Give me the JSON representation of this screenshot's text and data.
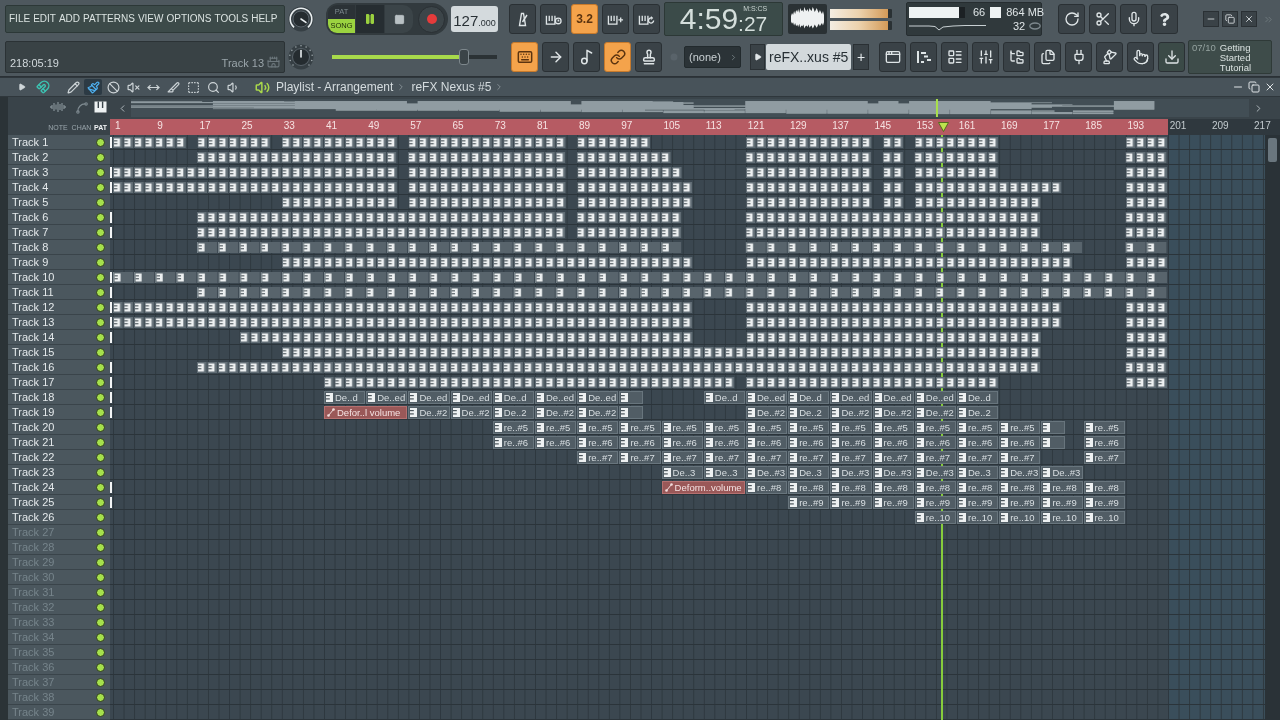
{
  "menu": [
    "FILE",
    "EDIT",
    "ADD",
    "PATTERNS",
    "VIEW",
    "OPTIONS",
    "TOOLS",
    "HELP"
  ],
  "modes": [
    {
      "label": "PAT",
      "selected": false
    },
    {
      "label": "SONG",
      "selected": true
    }
  ],
  "playing": true,
  "tempo": {
    "whole": "127",
    "fraction": ".000"
  },
  "record_tools": [
    {
      "active": false
    },
    {
      "active": false
    },
    {
      "label": "3.2",
      "active": true
    },
    {
      "active": false
    },
    {
      "active": false
    }
  ],
  "time": {
    "main": "4:59",
    "fraction": ":27",
    "format": "M:S:CS"
  },
  "peak_meters": [
    {
      "level": 0.93
    },
    {
      "level": 0.94
    }
  ],
  "cpu": {
    "level": 0.9,
    "reading": "66",
    "memory": "864 MB",
    "polyphony": "32"
  },
  "hint_bar": {
    "position": "218:05:19",
    "hint": "Track 13"
  },
  "main_slider": {
    "level": 0.8
  },
  "edit_tools": [
    {
      "active": true
    },
    {
      "active": false
    },
    {
      "active": false
    },
    {
      "active": true
    },
    {
      "active": false
    }
  ],
  "channel_selector": "(none)",
  "pattern_selector": {
    "value": "reFX..xus #5",
    "add": "+"
  },
  "tutorial": {
    "counter": "07/10",
    "title": "Getting Started Tutorial"
  },
  "playlist": {
    "title": "Playlist - Arrangement",
    "pattern": "reFX Nexus #5",
    "snap_on": true,
    "tools": [
      {
        "selected": false
      },
      {
        "selected": true
      },
      {
        "selected": false
      },
      {
        "selected": false
      },
      {
        "selected": false
      },
      {
        "selected": false
      },
      {
        "selected": false
      },
      {
        "selected": false
      },
      {
        "selected": false
      }
    ]
  },
  "filters": [
    {
      "label": "NOTE",
      "selected": false
    },
    {
      "label": "CHAN",
      "selected": false
    },
    {
      "label": "PAT",
      "selected": true
    }
  ],
  "ruler": [
    {
      "label": "1",
      "in_song": true
    },
    {
      "label": "9",
      "in_song": true
    },
    {
      "label": "17",
      "in_song": true
    },
    {
      "label": "25",
      "in_song": true
    },
    {
      "label": "33",
      "in_song": true
    },
    {
      "label": "41",
      "in_song": true
    },
    {
      "label": "49",
      "in_song": true
    },
    {
      "label": "57",
      "in_song": true
    },
    {
      "label": "65",
      "in_song": true
    },
    {
      "label": "73",
      "in_song": true
    },
    {
      "label": "81",
      "in_song": true
    },
    {
      "label": "89",
      "in_song": true
    },
    {
      "label": "97",
      "in_song": true
    },
    {
      "label": "105",
      "in_song": true
    },
    {
      "label": "113",
      "in_song": true
    },
    {
      "label": "121",
      "in_song": true
    },
    {
      "label": "129",
      "in_song": true
    },
    {
      "label": "137",
      "in_song": true
    },
    {
      "label": "145",
      "in_song": true
    },
    {
      "label": "153",
      "in_song": true
    },
    {
      "label": "161",
      "in_song": true
    },
    {
      "label": "169",
      "in_song": true
    },
    {
      "label": "177",
      "in_song": true
    },
    {
      "label": "185",
      "in_song": true
    },
    {
      "label": "193",
      "in_song": true
    },
    {
      "label": "201",
      "in_song": false
    },
    {
      "label": "209",
      "in_song": false
    },
    {
      "label": "217",
      "in_song": false
    }
  ],
  "playhead": {
    "level": 0.72
  },
  "tracks": [
    {
      "name": "Track 1",
      "dimmed": false,
      "on": true,
      "marker": true
    },
    {
      "name": "Track 2",
      "dimmed": false,
      "on": true,
      "marker": false
    },
    {
      "name": "Track 3",
      "dimmed": false,
      "on": true,
      "marker": true
    },
    {
      "name": "Track 4",
      "dimmed": false,
      "on": true,
      "marker": true
    },
    {
      "name": "Track 5",
      "dimmed": false,
      "on": true,
      "marker": false
    },
    {
      "name": "Track 6",
      "dimmed": false,
      "on": true,
      "marker": true
    },
    {
      "name": "Track 7",
      "dimmed": false,
      "on": true,
      "marker": true
    },
    {
      "name": "Track 8",
      "dimmed": false,
      "on": true,
      "marker": false
    },
    {
      "name": "Track 9",
      "dimmed": false,
      "on": true,
      "marker": false
    },
    {
      "name": "Track 10",
      "dimmed": false,
      "on": true,
      "marker": true
    },
    {
      "name": "Track 11",
      "dimmed": false,
      "on": true,
      "marker": true
    },
    {
      "name": "Track 12",
      "dimmed": false,
      "on": true,
      "marker": true
    },
    {
      "name": "Track 13",
      "dimmed": false,
      "on": true,
      "marker": true
    },
    {
      "name": "Track 14",
      "dimmed": false,
      "on": true,
      "marker": true
    },
    {
      "name": "Track 15",
      "dimmed": false,
      "on": true,
      "marker": false
    },
    {
      "name": "Track 16",
      "dimmed": false,
      "on": true,
      "marker": true
    },
    {
      "name": "Track 17",
      "dimmed": false,
      "on": true,
      "marker": true
    },
    {
      "name": "Track 18",
      "dimmed": false,
      "on": true,
      "marker": true,
      "lane": [
        {
          "kind": "empty"
        },
        {
          "kind": "empty"
        },
        {
          "kind": "empty"
        },
        {
          "kind": "empty"
        },
        {
          "kind": "empty"
        },
        {
          "kind": "pattern",
          "label": "De..d"
        },
        {
          "kind": "pattern",
          "label": "De..ed"
        },
        {
          "kind": "pattern",
          "label": "De..ed"
        },
        {
          "kind": "pattern",
          "label": "De..ed"
        },
        {
          "kind": "pattern",
          "label": "De..d"
        },
        {
          "kind": "pattern",
          "label": "De..ed"
        },
        {
          "kind": "pattern",
          "label": "De..ed"
        },
        {
          "kind": "stub"
        },
        {
          "kind": "empty"
        },
        {
          "kind": "pattern",
          "label": "De..d"
        },
        {
          "kind": "pattern",
          "label": "De..ed"
        },
        {
          "kind": "pattern",
          "label": "De..d"
        },
        {
          "kind": "pattern",
          "label": "De..ed"
        },
        {
          "kind": "pattern",
          "label": "De..ed"
        },
        {
          "kind": "pattern",
          "label": "De..ed"
        },
        {
          "kind": "pattern",
          "label": "De..d"
        }
      ]
    },
    {
      "name": "Track 19",
      "dimmed": false,
      "on": true,
      "marker": true,
      "lane": [
        {
          "kind": "empty"
        },
        {
          "kind": "empty"
        },
        {
          "kind": "empty"
        },
        {
          "kind": "empty"
        },
        {
          "kind": "empty"
        },
        {
          "kind": "automation",
          "label": "Defor..l volume"
        },
        {
          "kind": "pattern",
          "label": "De..#2"
        },
        {
          "kind": "pattern",
          "label": "De..#2"
        },
        {
          "kind": "pattern",
          "label": "De..2"
        },
        {
          "kind": "pattern",
          "label": "De..#2"
        },
        {
          "kind": "pattern",
          "label": "De..#2"
        },
        {
          "kind": "stub"
        },
        {
          "kind": "empty"
        },
        {
          "kind": "empty"
        },
        {
          "kind": "pattern",
          "label": "De..#2"
        },
        {
          "kind": "pattern",
          "label": "De..2"
        },
        {
          "kind": "pattern",
          "label": "De..#2"
        },
        {
          "kind": "pattern",
          "label": "De..#2"
        },
        {
          "kind": "pattern",
          "label": "De..#2"
        },
        {
          "kind": "pattern",
          "label": "De..2"
        }
      ]
    },
    {
      "name": "Track 20",
      "dimmed": false,
      "on": true,
      "marker": false,
      "lane": [
        {
          "kind": "empty"
        },
        {
          "kind": "empty"
        },
        {
          "kind": "empty"
        },
        {
          "kind": "empty"
        },
        {
          "kind": "empty"
        },
        {
          "kind": "empty"
        },
        {
          "kind": "empty"
        },
        {
          "kind": "empty"
        },
        {
          "kind": "empty"
        },
        {
          "kind": "pattern",
          "label": "re..#5"
        },
        {
          "kind": "pattern",
          "label": "re..#5"
        },
        {
          "kind": "pattern",
          "label": "re..#5"
        },
        {
          "kind": "pattern",
          "label": "re..#5"
        },
        {
          "kind": "pattern",
          "label": "re..#5"
        },
        {
          "kind": "pattern",
          "label": "re..#5"
        },
        {
          "kind": "pattern",
          "label": "re..#5"
        },
        {
          "kind": "pattern",
          "label": "re..#5"
        },
        {
          "kind": "pattern",
          "label": "re..#5"
        },
        {
          "kind": "pattern",
          "label": "re..#5"
        },
        {
          "kind": "pattern",
          "label": "re..#5"
        },
        {
          "kind": "pattern",
          "label": "re..#5"
        },
        {
          "kind": "pattern",
          "label": "re..#5"
        },
        {
          "kind": "stub"
        },
        {
          "kind": "pattern",
          "label": "re..#5"
        }
      ]
    },
    {
      "name": "Track 21",
      "dimmed": false,
      "on": true,
      "marker": false,
      "lane": [
        {
          "kind": "empty"
        },
        {
          "kind": "empty"
        },
        {
          "kind": "empty"
        },
        {
          "kind": "empty"
        },
        {
          "kind": "empty"
        },
        {
          "kind": "empty"
        },
        {
          "kind": "empty"
        },
        {
          "kind": "empty"
        },
        {
          "kind": "empty"
        },
        {
          "kind": "pattern",
          "label": "re..#6"
        },
        {
          "kind": "pattern",
          "label": "re..#6"
        },
        {
          "kind": "pattern",
          "label": "re..#6"
        },
        {
          "kind": "pattern",
          "label": "re..#6"
        },
        {
          "kind": "pattern",
          "label": "re..#6"
        },
        {
          "kind": "pattern",
          "label": "re..#6"
        },
        {
          "kind": "pattern",
          "label": "re..#6"
        },
        {
          "kind": "pattern",
          "label": "re..#6"
        },
        {
          "kind": "pattern",
          "label": "re..#6"
        },
        {
          "kind": "pattern",
          "label": "re..#6"
        },
        {
          "kind": "pattern",
          "label": "re..#6"
        },
        {
          "kind": "pattern",
          "label": "re..#6"
        },
        {
          "kind": "pattern",
          "label": "re..#6"
        },
        {
          "kind": "stub"
        },
        {
          "kind": "pattern",
          "label": "re..#6"
        }
      ]
    },
    {
      "name": "Track 22",
      "dimmed": false,
      "on": true,
      "marker": false,
      "lane": [
        {
          "kind": "empty"
        },
        {
          "kind": "empty"
        },
        {
          "kind": "empty"
        },
        {
          "kind": "empty"
        },
        {
          "kind": "empty"
        },
        {
          "kind": "empty"
        },
        {
          "kind": "empty"
        },
        {
          "kind": "empty"
        },
        {
          "kind": "empty"
        },
        {
          "kind": "empty"
        },
        {
          "kind": "empty"
        },
        {
          "kind": "pattern",
          "label": "re..#7"
        },
        {
          "kind": "pattern",
          "label": "re..#7"
        },
        {
          "kind": "pattern",
          "label": "re..#7"
        },
        {
          "kind": "pattern",
          "label": "re..#7"
        },
        {
          "kind": "pattern",
          "label": "re..#7"
        },
        {
          "kind": "pattern",
          "label": "re..#7"
        },
        {
          "kind": "pattern",
          "label": "re..#7"
        },
        {
          "kind": "pattern",
          "label": "re..#7"
        },
        {
          "kind": "pattern",
          "label": "re..#7"
        },
        {
          "kind": "pattern",
          "label": "re..#7"
        },
        {
          "kind": "pattern",
          "label": "re..#7"
        },
        {
          "kind": "empty"
        },
        {
          "kind": "pattern",
          "label": "re..#7"
        }
      ]
    },
    {
      "name": "Track 23",
      "dimmed": false,
      "on": true,
      "marker": false,
      "lane": [
        {
          "kind": "empty"
        },
        {
          "kind": "empty"
        },
        {
          "kind": "empty"
        },
        {
          "kind": "empty"
        },
        {
          "kind": "empty"
        },
        {
          "kind": "empty"
        },
        {
          "kind": "empty"
        },
        {
          "kind": "empty"
        },
        {
          "kind": "empty"
        },
        {
          "kind": "empty"
        },
        {
          "kind": "empty"
        },
        {
          "kind": "empty"
        },
        {
          "kind": "empty"
        },
        {
          "kind": "pattern",
          "label": "De..3"
        },
        {
          "kind": "pattern",
          "label": "De..3"
        },
        {
          "kind": "pattern",
          "label": "De..#3"
        },
        {
          "kind": "pattern",
          "label": "De..3"
        },
        {
          "kind": "pattern",
          "label": "De..#3"
        },
        {
          "kind": "pattern",
          "label": "De..#3"
        },
        {
          "kind": "pattern",
          "label": "De..#3"
        },
        {
          "kind": "pattern",
          "label": "De..3"
        },
        {
          "kind": "pattern",
          "label": "De..#3"
        },
        {
          "kind": "pattern",
          "label": "De..#3"
        }
      ]
    },
    {
      "name": "Track 24",
      "dimmed": false,
      "on": true,
      "marker": true,
      "lane": [
        {
          "kind": "empty"
        },
        {
          "kind": "empty"
        },
        {
          "kind": "empty"
        },
        {
          "kind": "empty"
        },
        {
          "kind": "empty"
        },
        {
          "kind": "empty"
        },
        {
          "kind": "empty"
        },
        {
          "kind": "empty"
        },
        {
          "kind": "empty"
        },
        {
          "kind": "empty"
        },
        {
          "kind": "empty"
        },
        {
          "kind": "empty"
        },
        {
          "kind": "empty"
        },
        {
          "kind": "automation",
          "label": "Deform..volume"
        },
        {
          "kind": "pattern",
          "label": "re..#8"
        },
        {
          "kind": "pattern",
          "label": "re..#8"
        },
        {
          "kind": "pattern",
          "label": "re..#8"
        },
        {
          "kind": "pattern",
          "label": "re..#8"
        },
        {
          "kind": "pattern",
          "label": "re..#8"
        },
        {
          "kind": "pattern",
          "label": "re..#8"
        },
        {
          "kind": "pattern",
          "label": "re..#8"
        },
        {
          "kind": "pattern",
          "label": "re..#8"
        },
        {
          "kind": "pattern",
          "label": "re..#8"
        }
      ]
    },
    {
      "name": "Track 25",
      "dimmed": false,
      "on": true,
      "marker": true,
      "lane": [
        {
          "kind": "empty"
        },
        {
          "kind": "empty"
        },
        {
          "kind": "empty"
        },
        {
          "kind": "empty"
        },
        {
          "kind": "empty"
        },
        {
          "kind": "empty"
        },
        {
          "kind": "empty"
        },
        {
          "kind": "empty"
        },
        {
          "kind": "empty"
        },
        {
          "kind": "empty"
        },
        {
          "kind": "empty"
        },
        {
          "kind": "empty"
        },
        {
          "kind": "empty"
        },
        {
          "kind": "empty"
        },
        {
          "kind": "empty"
        },
        {
          "kind": "empty"
        },
        {
          "kind": "pattern",
          "label": "re..#9"
        },
        {
          "kind": "pattern",
          "label": "re..#9"
        },
        {
          "kind": "pattern",
          "label": "re..#9"
        },
        {
          "kind": "pattern",
          "label": "re..#9"
        },
        {
          "kind": "pattern",
          "label": "re..#9"
        },
        {
          "kind": "pattern",
          "label": "re..#9"
        },
        {
          "kind": "pattern",
          "label": "re..#9"
        },
        {
          "kind": "pattern",
          "label": "re..#9"
        }
      ]
    },
    {
      "name": "Track 26",
      "dimmed": false,
      "on": true,
      "marker": false,
      "lane": [
        {
          "kind": "empty"
        },
        {
          "kind": "empty"
        },
        {
          "kind": "empty"
        },
        {
          "kind": "empty"
        },
        {
          "kind": "empty"
        },
        {
          "kind": "empty"
        },
        {
          "kind": "empty"
        },
        {
          "kind": "empty"
        },
        {
          "kind": "empty"
        },
        {
          "kind": "empty"
        },
        {
          "kind": "empty"
        },
        {
          "kind": "empty"
        },
        {
          "kind": "empty"
        },
        {
          "kind": "empty"
        },
        {
          "kind": "empty"
        },
        {
          "kind": "empty"
        },
        {
          "kind": "empty"
        },
        {
          "kind": "empty"
        },
        {
          "kind": "empty"
        },
        {
          "kind": "pattern",
          "label": "re..10"
        },
        {
          "kind": "pattern",
          "label": "re..10"
        },
        {
          "kind": "pattern",
          "label": "re..10"
        },
        {
          "kind": "pattern",
          "label": "re..10"
        },
        {
          "kind": "pattern",
          "label": "re..10"
        }
      ]
    },
    {
      "name": "Track 27",
      "dimmed": true,
      "on": true,
      "marker": false
    },
    {
      "name": "Track 28",
      "dimmed": true,
      "on": true,
      "marker": false
    },
    {
      "name": "Track 29",
      "dimmed": true,
      "on": true,
      "marker": false
    },
    {
      "name": "Track 30",
      "dimmed": true,
      "on": true,
      "marker": false
    },
    {
      "name": "Track 31",
      "dimmed": true,
      "on": true,
      "marker": false
    },
    {
      "name": "Track 32",
      "dimmed": true,
      "on": true,
      "marker": false
    },
    {
      "name": "Track 33",
      "dimmed": true,
      "on": true,
      "marker": false
    },
    {
      "name": "Track 34",
      "dimmed": true,
      "on": true,
      "marker": false
    },
    {
      "name": "Track 35",
      "dimmed": true,
      "on": true,
      "marker": false
    },
    {
      "name": "Track 36",
      "dimmed": true,
      "on": true,
      "marker": false
    },
    {
      "name": "Track 37",
      "dimmed": true,
      "on": true,
      "marker": false
    },
    {
      "name": "Track 38",
      "dimmed": true,
      "on": true,
      "marker": false
    },
    {
      "name": "Track 39",
      "dimmed": true,
      "on": true,
      "marker": false
    }
  ]
}
